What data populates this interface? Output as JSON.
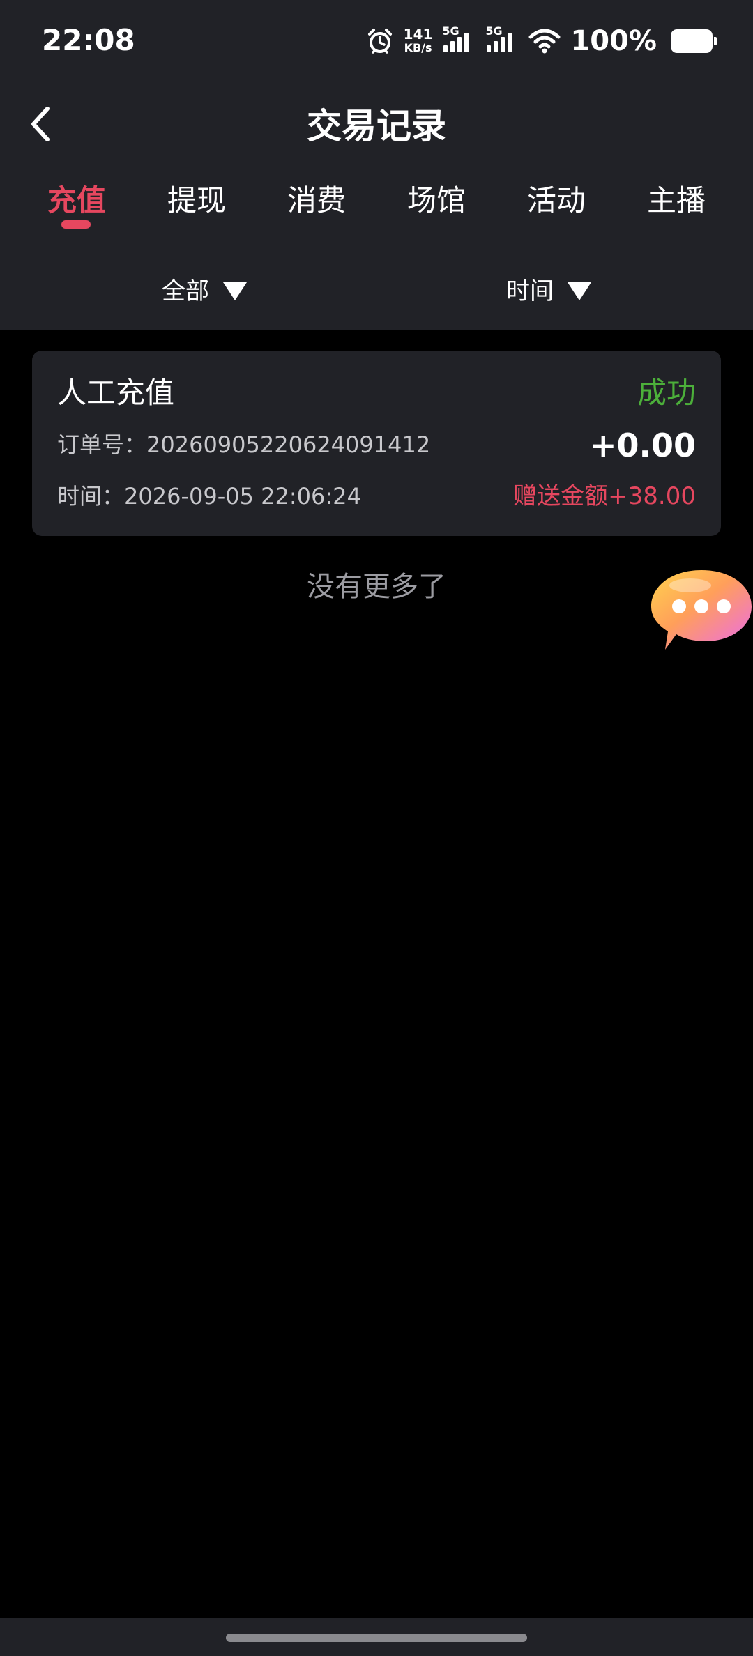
{
  "status_bar": {
    "time": "22:08",
    "net_speed_value": "141",
    "net_speed_unit": "KB/s",
    "sim1_tag": "5G",
    "sim2_tag": "5G",
    "battery": "100%"
  },
  "header": {
    "title": "交易记录",
    "tabs": [
      {
        "label": "充值",
        "active": true
      },
      {
        "label": "提现",
        "active": false
      },
      {
        "label": "消费",
        "active": false
      },
      {
        "label": "场馆",
        "active": false
      },
      {
        "label": "活动",
        "active": false
      },
      {
        "label": "主播",
        "active": false
      }
    ]
  },
  "filters": {
    "category": "全部",
    "time": "时间"
  },
  "records": [
    {
      "title": "人工充值",
      "status": "成功",
      "order_label": "订单号：20260905220624091412",
      "amount": "+0.00",
      "time_label": "时间：2026-09-05 22:06:24",
      "bonus": "赠送金额+38.00"
    }
  ],
  "list_footer": "没有更多了",
  "colors": {
    "accent": "#e6475f",
    "success": "#4caf3a",
    "panel": "#212227",
    "background": "#000000"
  },
  "icons": [
    "alarm-icon",
    "signal-icon",
    "wifi-icon",
    "battery-icon",
    "back-arrow-icon",
    "triangle-down-icon",
    "chat-bubble-icon"
  ]
}
